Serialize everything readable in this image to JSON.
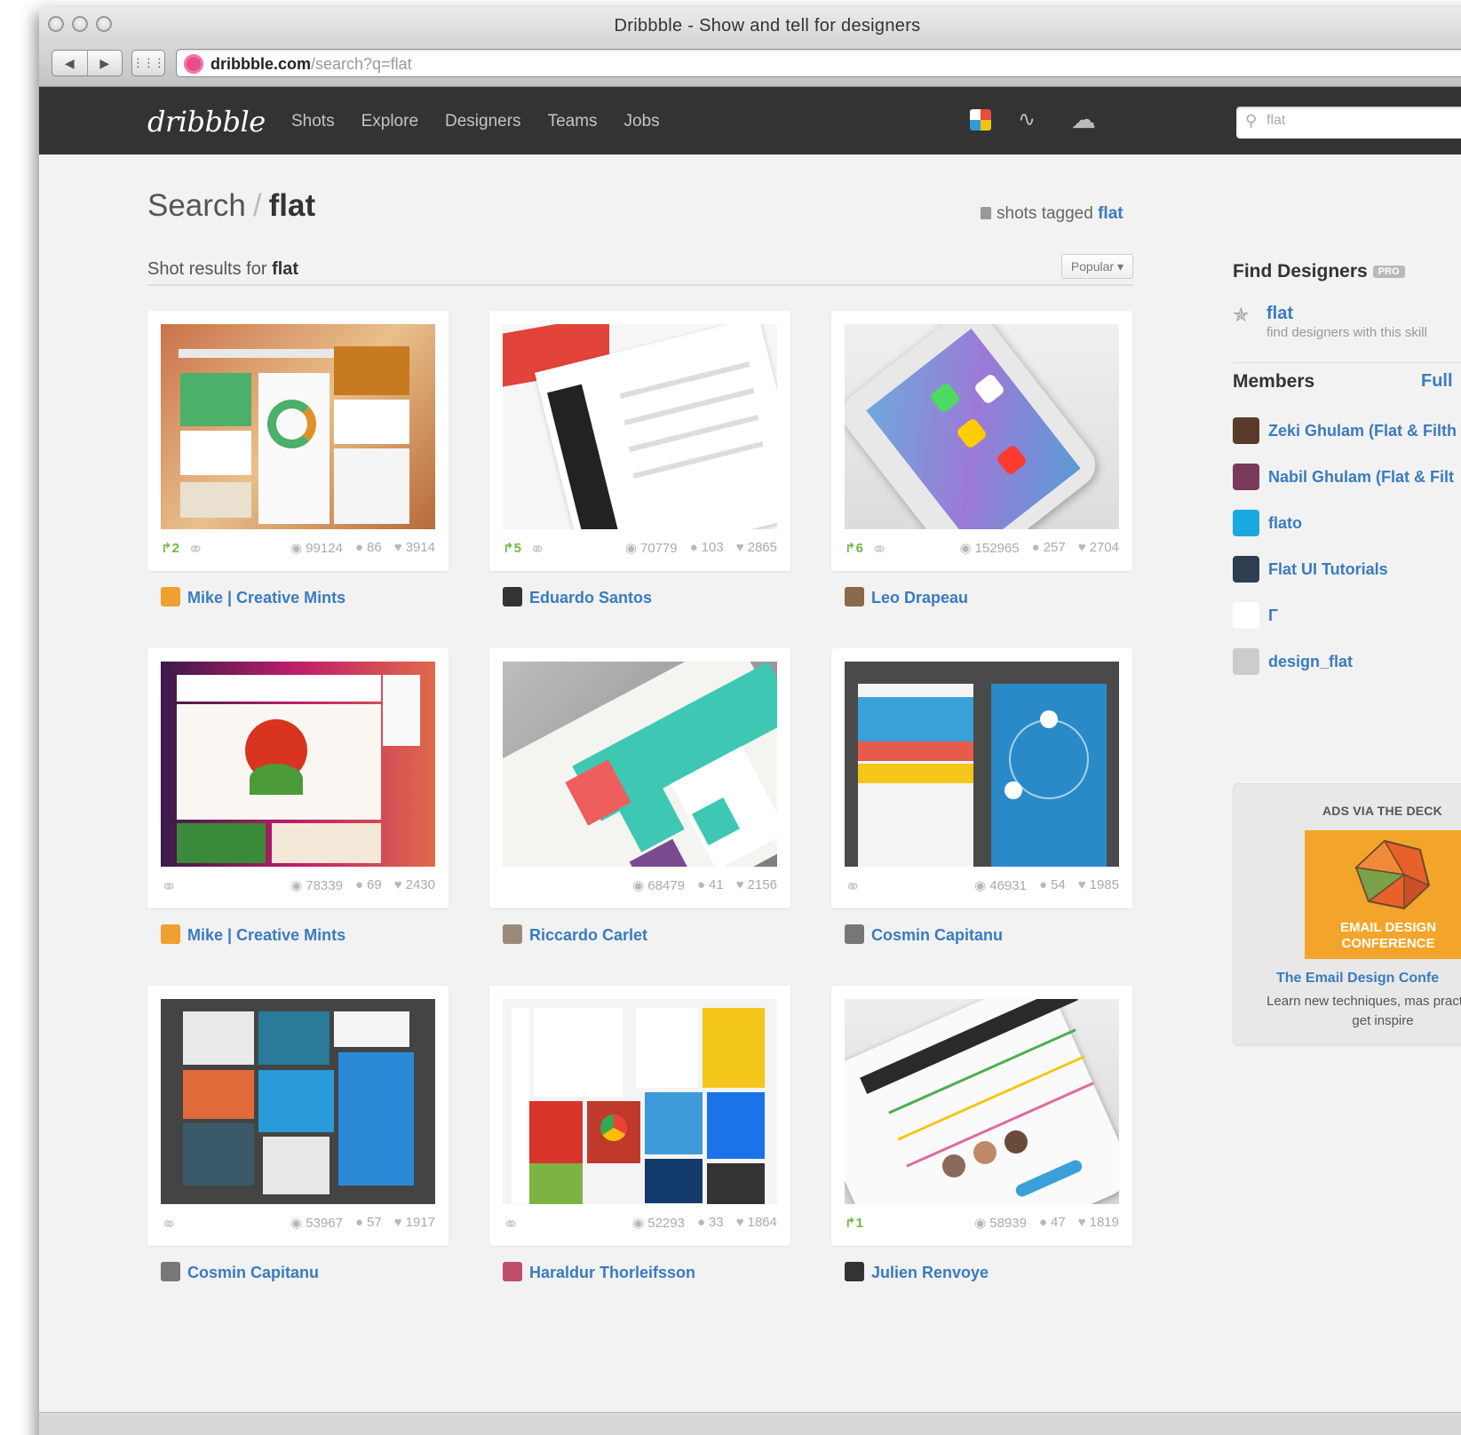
{
  "window": {
    "title": "Dribbble - Show and tell for designers"
  },
  "browser": {
    "url_host": "dribbble.com",
    "url_path": "/search?q=flat"
  },
  "nav": {
    "logo": "dribbble",
    "links": [
      "Shots",
      "Explore",
      "Designers",
      "Teams",
      "Jobs"
    ],
    "search_value": "flat"
  },
  "page": {
    "heading_prefix": "Search",
    "heading_sep": "/",
    "heading_term": "flat",
    "tagged_prefix": "shots tagged",
    "tagged_term": "flat",
    "results_prefix": "Shot results for",
    "results_term": "flat",
    "sort": "Popular"
  },
  "shots": [
    {
      "rebounds": "2",
      "attach": true,
      "views": "99124",
      "comments": "86",
      "likes": "3914",
      "author": "Mike | Creative Mints",
      "avatar_color": "#f0a030",
      "thumb": "dashboard-warm"
    },
    {
      "rebounds": "5",
      "attach": true,
      "views": "70779",
      "comments": "103",
      "likes": "2865",
      "author": "Eduardo Santos",
      "avatar_color": "#333333",
      "thumb": "inbox-app"
    },
    {
      "rebounds": "6",
      "attach": true,
      "views": "152965",
      "comments": "257",
      "likes": "2704",
      "author": "Leo Drapeau",
      "avatar_color": "#8a6a4a",
      "thumb": "iphone-ios7"
    },
    {
      "rebounds": "",
      "attach": true,
      "views": "78339",
      "comments": "69",
      "likes": "2430",
      "author": "Mike | Creative Mints",
      "avatar_color": "#f0a030",
      "thumb": "natural-food"
    },
    {
      "rebounds": "",
      "attach": false,
      "views": "68479",
      "comments": "41",
      "likes": "2156",
      "author": "Riccardo Carlet",
      "avatar_color": "#9a8a7a",
      "thumb": "calendar-phone"
    },
    {
      "rebounds": "",
      "attach": true,
      "views": "46931",
      "comments": "54",
      "likes": "1985",
      "author": "Cosmin Capitanu",
      "avatar_color": "#777777",
      "thumb": "travel-app"
    },
    {
      "rebounds": "",
      "attach": true,
      "views": "53967",
      "comments": "57",
      "likes": "1917",
      "author": "Cosmin Capitanu",
      "avatar_color": "#777777",
      "thumb": "weather-tiles"
    },
    {
      "rebounds": "",
      "attach": true,
      "views": "52293",
      "comments": "33",
      "likes": "1864",
      "author": "Haraldur Thorleifsson",
      "avatar_color": "#c0506a",
      "thumb": "google-tiles"
    },
    {
      "rebounds": "1",
      "attach": false,
      "views": "58939",
      "comments": "47",
      "likes": "1819",
      "author": "Julien Renvoye",
      "avatar_color": "#333333",
      "thumb": "gigs-app"
    }
  ],
  "sidebar": {
    "find_title": "Find Designers",
    "pro_badge": "PRO",
    "skill_name": "flat",
    "skill_desc": "find designers with this skill",
    "members_title": "Members",
    "full_link": "Full",
    "members": [
      {
        "name": "Zeki Ghulam (Flat & Filth",
        "avatar_color": "#5a3a2a"
      },
      {
        "name": "Nabil Ghulam (Flat & Filt",
        "avatar_color": "#7a3a5a"
      },
      {
        "name": "flato",
        "avatar_color": "#1aa8e0"
      },
      {
        "name": "Flat UI Tutorials",
        "avatar_color": "#2c3e50"
      },
      {
        "name": "Γ",
        "avatar_color": "#ffffff"
      },
      {
        "name": "design_flat",
        "avatar_color": "#cccccc"
      }
    ],
    "more_link": "Fu",
    "ad_head": "ADS VIA THE DECK",
    "ad_img_text": "EMAIL DESIGN CONFERENCE",
    "ad_title": "The Email Design Confe",
    "ad_text": "Learn new techniques, mas practices & get inspire"
  }
}
